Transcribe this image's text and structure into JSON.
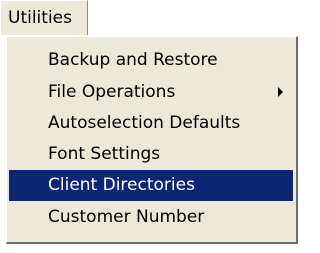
{
  "menu_bar": {
    "title": "Utilities"
  },
  "menu": {
    "items": [
      {
        "label": "Backup and Restore",
        "has_submenu": false,
        "selected": false
      },
      {
        "label": "File Operations",
        "has_submenu": true,
        "submenu_icon": "chevron-right-icon",
        "selected": false
      },
      {
        "label": "Autoselection Defaults",
        "has_submenu": false,
        "selected": false
      },
      {
        "label": "Font Settings",
        "has_submenu": false,
        "selected": false
      },
      {
        "label": "Client Directories",
        "has_submenu": false,
        "selected": true
      },
      {
        "label": "Customer Number",
        "has_submenu": false,
        "selected": false
      }
    ]
  },
  "colors": {
    "menu_background": "#ece9d8",
    "selection_background": "#0b2674",
    "selection_text": "#ffffff"
  }
}
